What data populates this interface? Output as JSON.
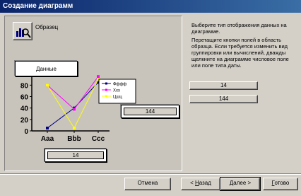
{
  "window": {
    "title": "Создание диаграмм"
  },
  "sample": {
    "label": "Образец",
    "icon": "chart-type-icon"
  },
  "fields": {
    "data_field": "Данные",
    "series_field_value": "144",
    "category_field_value": "14"
  },
  "info": {
    "line1": "Выберите тип отображения данных на диаграмме.",
    "line2": "Перетащите кнопки полей в область образца. Если требуется изменить вид группировки или вычислений, дважды щелкните на диаграмме числовое поле или поле типа даты."
  },
  "field_buttons": [
    "14",
    "144"
  ],
  "buttons": {
    "cancel": "Отмена",
    "back_prefix": "< ",
    "back_accel": "Н",
    "back_rest": "азад",
    "next_accel": "Д",
    "next_rest": "алее >",
    "finish_accel": "Г",
    "finish_rest": "отово"
  },
  "chart_data": {
    "type": "line",
    "categories": [
      "Aaa",
      "Bbb",
      "Ccc"
    ],
    "series": [
      {
        "name": "Фффф",
        "values": [
          5,
          40,
          85
        ],
        "color": "#000080"
      },
      {
        "name": "Хxx",
        "values": [
          80,
          38,
          95
        ],
        "color": "#ff00ff"
      },
      {
        "name": "Цшц",
        "values": [
          80,
          5,
          90
        ],
        "color": "#ffff00"
      }
    ],
    "ylim": [
      0,
      120
    ],
    "yticks": [
      "0",
      "20",
      "40",
      "60",
      "80",
      "100",
      "120"
    ]
  }
}
